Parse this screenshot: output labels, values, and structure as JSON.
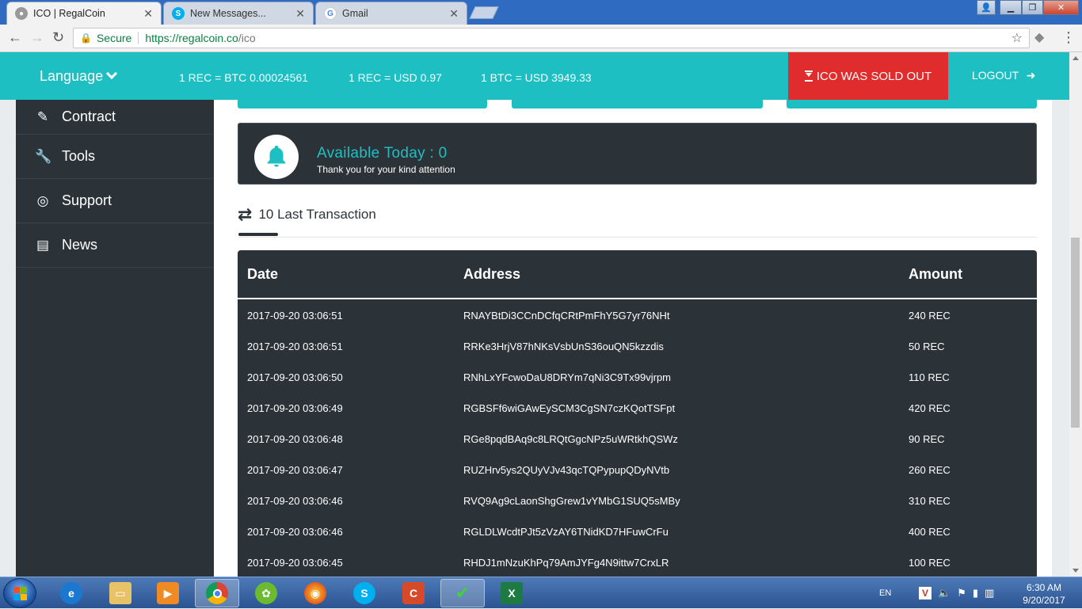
{
  "browser": {
    "tabs": [
      {
        "title": "ICO | RegalCoin",
        "active": true
      },
      {
        "title": "New Messages...",
        "active": false
      },
      {
        "title": "Gmail",
        "active": false
      }
    ],
    "address": {
      "secure_label": "Secure",
      "url_host": "https://regalcoin.co",
      "url_path": "/ico"
    }
  },
  "topbar": {
    "language_label": "Language",
    "rates": [
      "1 REC = BTC 0.00024561",
      "1 REC = USD 0.97",
      "1 BTC = USD 3949.33"
    ],
    "soldout_label": "ICO WAS SOLD OUT",
    "logout_label": "LOGOUT"
  },
  "sidebar": {
    "items": [
      {
        "label": "Contract",
        "icon": "edit-icon"
      },
      {
        "label": "Tools",
        "icon": "wrench-icon"
      },
      {
        "label": "Support",
        "icon": "lifebuoy-icon"
      },
      {
        "label": "News",
        "icon": "newspaper-icon"
      }
    ]
  },
  "notice": {
    "title": "Available Today : 0",
    "subtitle": "Thank you for your kind attention"
  },
  "transactions": {
    "title": "10 Last Transaction",
    "headers": {
      "date": "Date",
      "address": "Address",
      "amount": "Amount"
    },
    "rows": [
      {
        "date": "2017-09-20 03:06:51",
        "address": "RNAYBtDi3CCnDCfqCRtPmFhY5G7yr76NHt",
        "amount": "240 REC"
      },
      {
        "date": "2017-09-20 03:06:51",
        "address": "RRKe3HrjV87hNKsVsbUnS36ouQN5kzzdis",
        "amount": "50 REC"
      },
      {
        "date": "2017-09-20 03:06:50",
        "address": "RNhLxYFcwoDaU8DRYm7qNi3C9Tx99vjrpm",
        "amount": "110 REC"
      },
      {
        "date": "2017-09-20 03:06:49",
        "address": "RGBSFf6wiGAwEySCM3CgSN7czKQotTSFpt",
        "amount": "420 REC"
      },
      {
        "date": "2017-09-20 03:06:48",
        "address": "RGe8pqdBAq9c8LRQtGgcNPz5uWRtkhQSWz",
        "amount": "90 REC"
      },
      {
        "date": "2017-09-20 03:06:47",
        "address": "RUZHrv5ys2QUyVJv43qcTQPypupQDyNVtb",
        "amount": "260 REC"
      },
      {
        "date": "2017-09-20 03:06:46",
        "address": "RVQ9Ag9cLaonShgGrew1vYMbG1SUQ5sMBy",
        "amount": "310 REC"
      },
      {
        "date": "2017-09-20 03:06:46",
        "address": "RGLDLWcdtPJt5zVzAY6TNidKD7HFuwCrFu",
        "amount": "400 REC"
      },
      {
        "date": "2017-09-20 03:06:45",
        "address": "RHDJ1mNzuKhPq79AmJYFg4N9ittw7CrxLR",
        "amount": "100 REC"
      }
    ]
  },
  "taskbar": {
    "language": "EN",
    "time": "6:30 AM",
    "date": "9/20/2017"
  },
  "colors": {
    "teal": "#1ebfc3",
    "dark": "#2c3338",
    "soldout_red": "#e02c2c"
  }
}
